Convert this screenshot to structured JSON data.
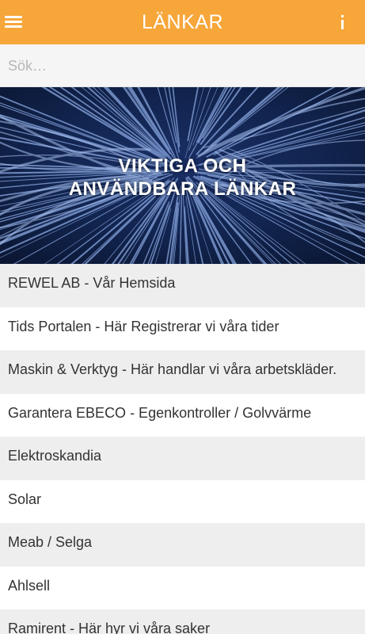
{
  "header": {
    "title": "LÄNKAR",
    "menu_icon": "hamburger-menu-icon",
    "info_icon": "info-icon",
    "bar_color": "#f7a63a"
  },
  "search": {
    "placeholder": "Sök…",
    "value": ""
  },
  "banner": {
    "title_line1": "VIKTIGA OCH",
    "title_line2": "ANVÄNDBARA LÄNKAR"
  },
  "links": [
    "REWEL AB - Vår Hemsida",
    "Tids Portalen - Här Registrerar vi våra tider",
    "Maskin & Verktyg - Här handlar vi våra arbetskläder.",
    "Garantera EBECO - Egenkontroller / Golvvärme",
    "Elektroskandia",
    "Solar",
    "Meab / Selga",
    "Ahlsell",
    "Ramirent - Här hyr vi våra saker"
  ]
}
